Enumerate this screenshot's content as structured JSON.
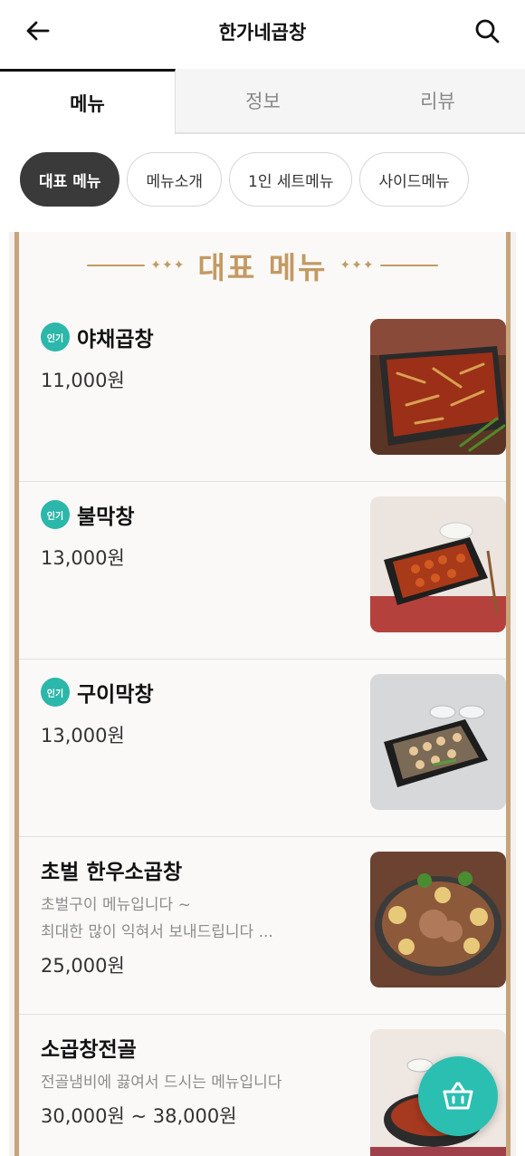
{
  "header": {
    "title": "한가네곱창",
    "back_icon": "arrow-left-icon",
    "search_icon": "search-icon"
  },
  "tabs": [
    {
      "label": "메뉴",
      "active": true
    },
    {
      "label": "정보",
      "active": false
    },
    {
      "label": "리뷰",
      "active": false
    }
  ],
  "chips": [
    {
      "label": "대표 메뉴",
      "active": true
    },
    {
      "label": "메뉴소개",
      "active": false
    },
    {
      "label": "1인 세트메뉴",
      "active": false
    },
    {
      "label": "사이드메뉴",
      "active": false
    }
  ],
  "section": {
    "title": "대표 메뉴",
    "decor": "✦✦✦"
  },
  "menu_items": [
    {
      "name": "야채곱창",
      "badge": "인기",
      "desc": [],
      "price": "11,000원"
    },
    {
      "name": "불막창",
      "badge": "인기",
      "desc": [],
      "price": "13,000원"
    },
    {
      "name": "구이막창",
      "badge": "인기",
      "desc": [],
      "price": "13,000원"
    },
    {
      "name": "초벌 한우소곱창",
      "badge": "",
      "desc": [
        "초벌구이 메뉴입니다 ~",
        "최대한 많이 익혀서 보내드립니다 ..."
      ],
      "price": "25,000원"
    },
    {
      "name": "소곱창전골",
      "badge": "",
      "desc": [
        "전골냄비에 끓여서 드시는 메뉴입니다"
      ],
      "price": "30,000원 ~ 38,000원"
    }
  ],
  "cart": {
    "icon": "basket-icon"
  },
  "colors": {
    "accent": "#2bbfb1",
    "gold": "#c39a62",
    "chip_active": "#3a3a3a"
  }
}
